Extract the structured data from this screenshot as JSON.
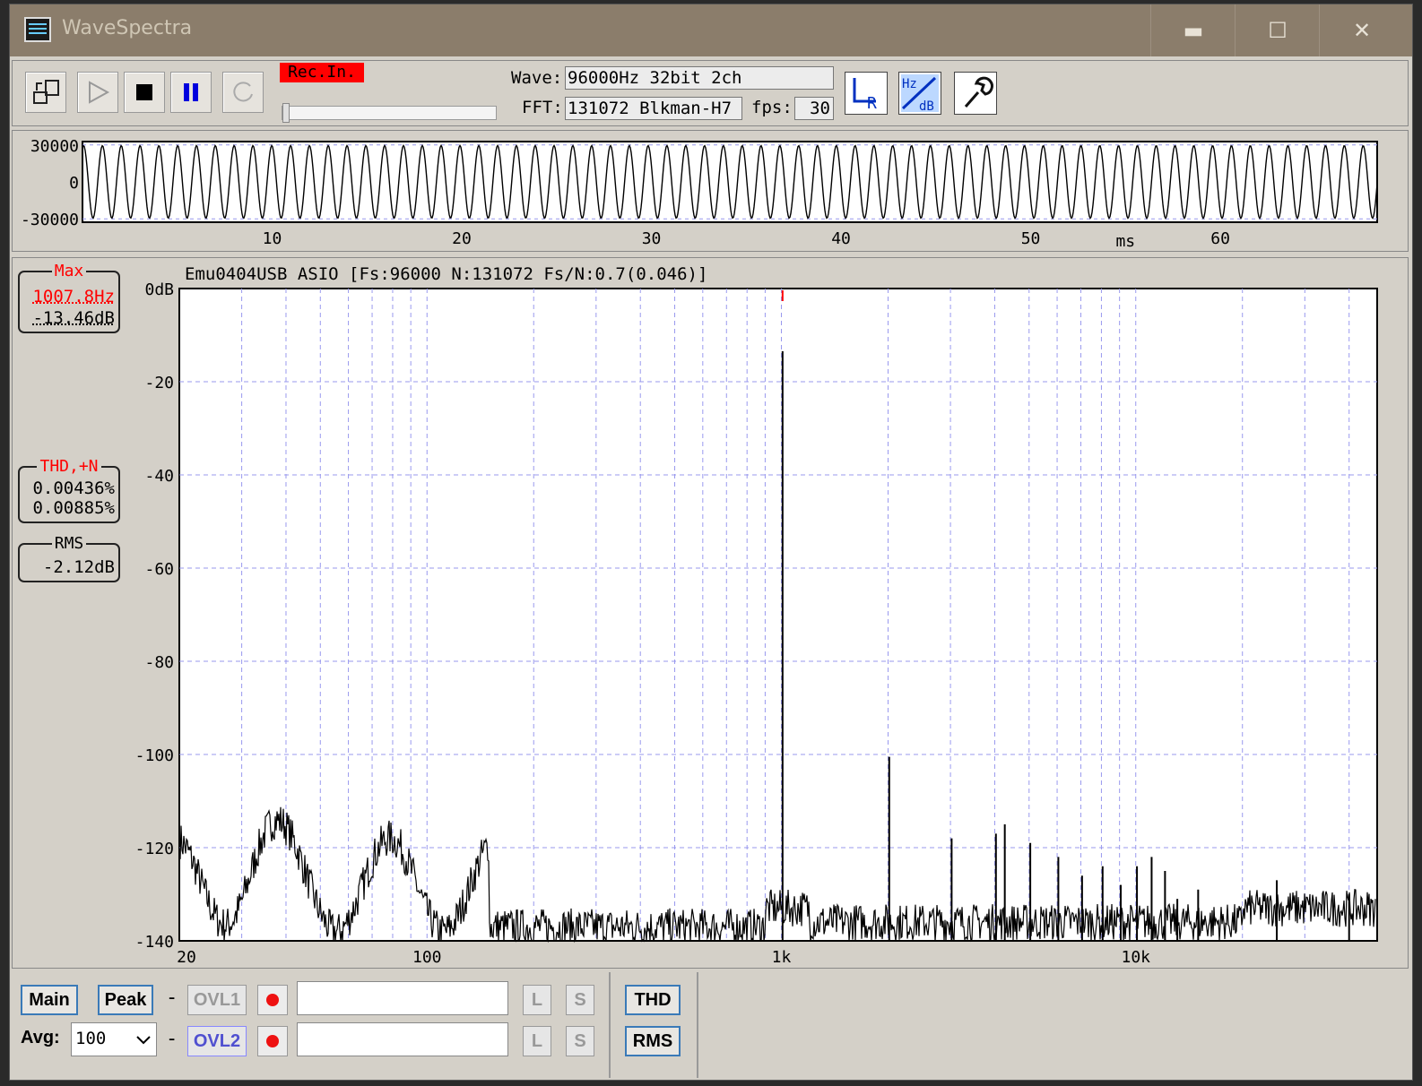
{
  "window": {
    "title": "WaveSpectra",
    "minimize_glyph": "▬",
    "maximize_glyph": "☐",
    "close_glyph": "✕",
    "title_bar_color": "#8b7d6b"
  },
  "toolbar": {
    "rec_indicator": "Rec.In.",
    "wave_label": "Wave:",
    "wave_value": "96000Hz 32bit 2ch",
    "fft_label": "FFT:",
    "fft_value": "131072 Blkman-H7",
    "fps_label": "fps:",
    "fps_value": "30",
    "lr_icon_text": "R",
    "hzdb_icon_text_top": "Hz",
    "hzdb_icon_text_bottom": "dB",
    "buttons": [
      "export-icon",
      "play-icon",
      "stop-icon",
      "pause-icon",
      "loop-icon"
    ],
    "rec_color": "#ff0000"
  },
  "waveform": {
    "y_ticks": [
      "30000",
      "0",
      "-30000"
    ],
    "x_ticks": [
      "10",
      "20",
      "30",
      "40",
      "50",
      "60"
    ],
    "x_unit": "ms",
    "signal_frequency_hz": 1007.8,
    "y_range": [
      -32768,
      32767
    ],
    "x_range_ms": [
      0,
      68.27
    ],
    "amplitude_fraction": 0.9
  },
  "spectrum": {
    "header": "Emu0404USB ASIO   [Fs:96000 N:131072 Fs/N:0.7(0.046)]",
    "y_ticks": [
      "0dB",
      "-20",
      "-40",
      "-60",
      "-80",
      "-100",
      "-120",
      "-140"
    ],
    "x_ticks": [
      "20",
      "100",
      "1k",
      "10k"
    ],
    "x_range_hz": [
      20,
      48000
    ],
    "y_range_db": [
      -140,
      0
    ],
    "grid_color": "#9999ee",
    "peak_marker_color": "#ff0000",
    "peaks": [
      {
        "f": 1007.8,
        "db": -13.46
      },
      {
        "f": 2015,
        "db": -100.5
      },
      {
        "f": 3023,
        "db": -118
      },
      {
        "f": 4031,
        "db": -117
      },
      {
        "f": 4270,
        "db": -115
      },
      {
        "f": 5039,
        "db": -119
      },
      {
        "f": 6047,
        "db": -122
      },
      {
        "f": 7055,
        "db": -126
      },
      {
        "f": 8063,
        "db": -124
      },
      {
        "f": 9070,
        "db": -128
      },
      {
        "f": 10078,
        "db": -124
      },
      {
        "f": 11086,
        "db": -122
      },
      {
        "f": 12094,
        "db": -125
      },
      {
        "f": 13101,
        "db": -131
      },
      {
        "f": 15000,
        "db": -129
      },
      {
        "f": 25000,
        "db": -127
      },
      {
        "f": 40000,
        "db": -130
      }
    ]
  },
  "readouts": {
    "max_label": "Max",
    "max_freq": "1007.8Hz",
    "max_db": "-13.46dB",
    "thd_label": "THD,+N",
    "thd_value": "0.00436%",
    "thdn_value": "0.00885%",
    "rms_label": "RMS",
    "rms_value": "-2.12dB",
    "label_color": "#ff0000"
  },
  "bottom": {
    "main_label": "Main",
    "peak_label": "Peak",
    "dash": "-",
    "ovl1_label": "OVL1",
    "ovl2_label": "OVL2",
    "avg_label": "Avg:",
    "avg_value": "100",
    "l_label": "L",
    "s_label": "S",
    "thd_button": "THD",
    "rms_button": "RMS",
    "ovl1_text": "",
    "ovl2_text": ""
  }
}
